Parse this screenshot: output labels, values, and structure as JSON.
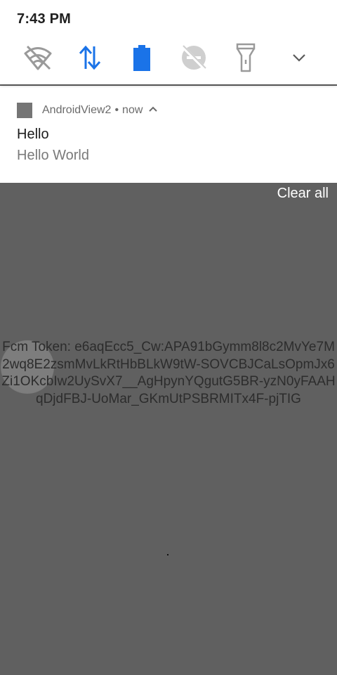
{
  "status_bar": {
    "time": "7:43 PM"
  },
  "quick_settings": {
    "tiles": [
      {
        "name": "wifi-off-icon"
      },
      {
        "name": "mobile-data-icon",
        "color": "#1a73e8"
      },
      {
        "name": "battery-icon",
        "color": "#1a73e8"
      },
      {
        "name": "do-not-disturb-off-icon"
      },
      {
        "name": "flashlight-icon"
      },
      {
        "name": "expand-chevron-icon"
      }
    ]
  },
  "notification": {
    "app_name": "AndroidView2",
    "separator": "•",
    "time": "now",
    "title": "Hello",
    "text": "Hello World"
  },
  "shade": {
    "clear_all": "Clear all"
  },
  "app": {
    "token_text": "Fcm Token: e6aqEcc5_Cw:APA91bGymm8l8c2MvYe7M2wq8E2zsmMvLkRtHbBLkW9tW-SOVCBJCaLsOpmJx6Zi1OKcbIw2UySvX7__AgHpynYQgutG5BR-yzN0yFAAHqDjdFBJ-UoMar_GKmUtPSBRMITx4F-pjTIG"
  },
  "colors": {
    "accent": "#1a73e8",
    "scrim": "#606060",
    "panel": "#ffffff"
  }
}
